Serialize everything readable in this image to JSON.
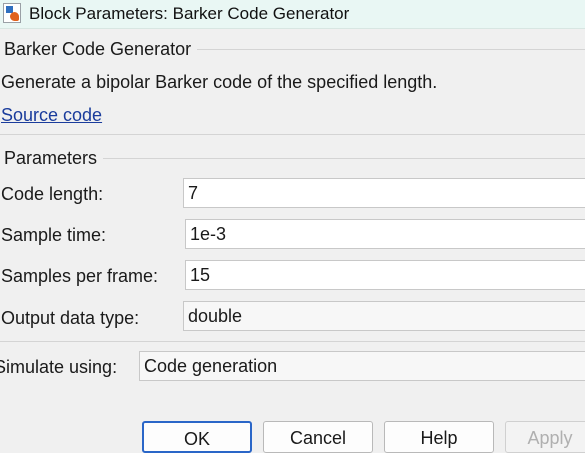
{
  "window": {
    "title": "Block Parameters: Barker Code Generator"
  },
  "block": {
    "name": "Barker Code Generator",
    "description": "Generate a bipolar Barker code of the specified length.",
    "source_link": "Source code"
  },
  "parameters": {
    "header": "Parameters",
    "code_length": {
      "label": "Code length:",
      "value": "7"
    },
    "sample_time": {
      "label": "Sample time:",
      "value": "1e-3"
    },
    "samples_per_frame": {
      "label": "Samples per frame:",
      "value": "15"
    },
    "output_data_type": {
      "label": "Output data type:",
      "value": "double"
    }
  },
  "simulate": {
    "label": "Simulate using:",
    "value": "Code generation"
  },
  "buttons": {
    "ok": "OK",
    "cancel": "Cancel",
    "help": "Help",
    "apply": "Apply"
  }
}
